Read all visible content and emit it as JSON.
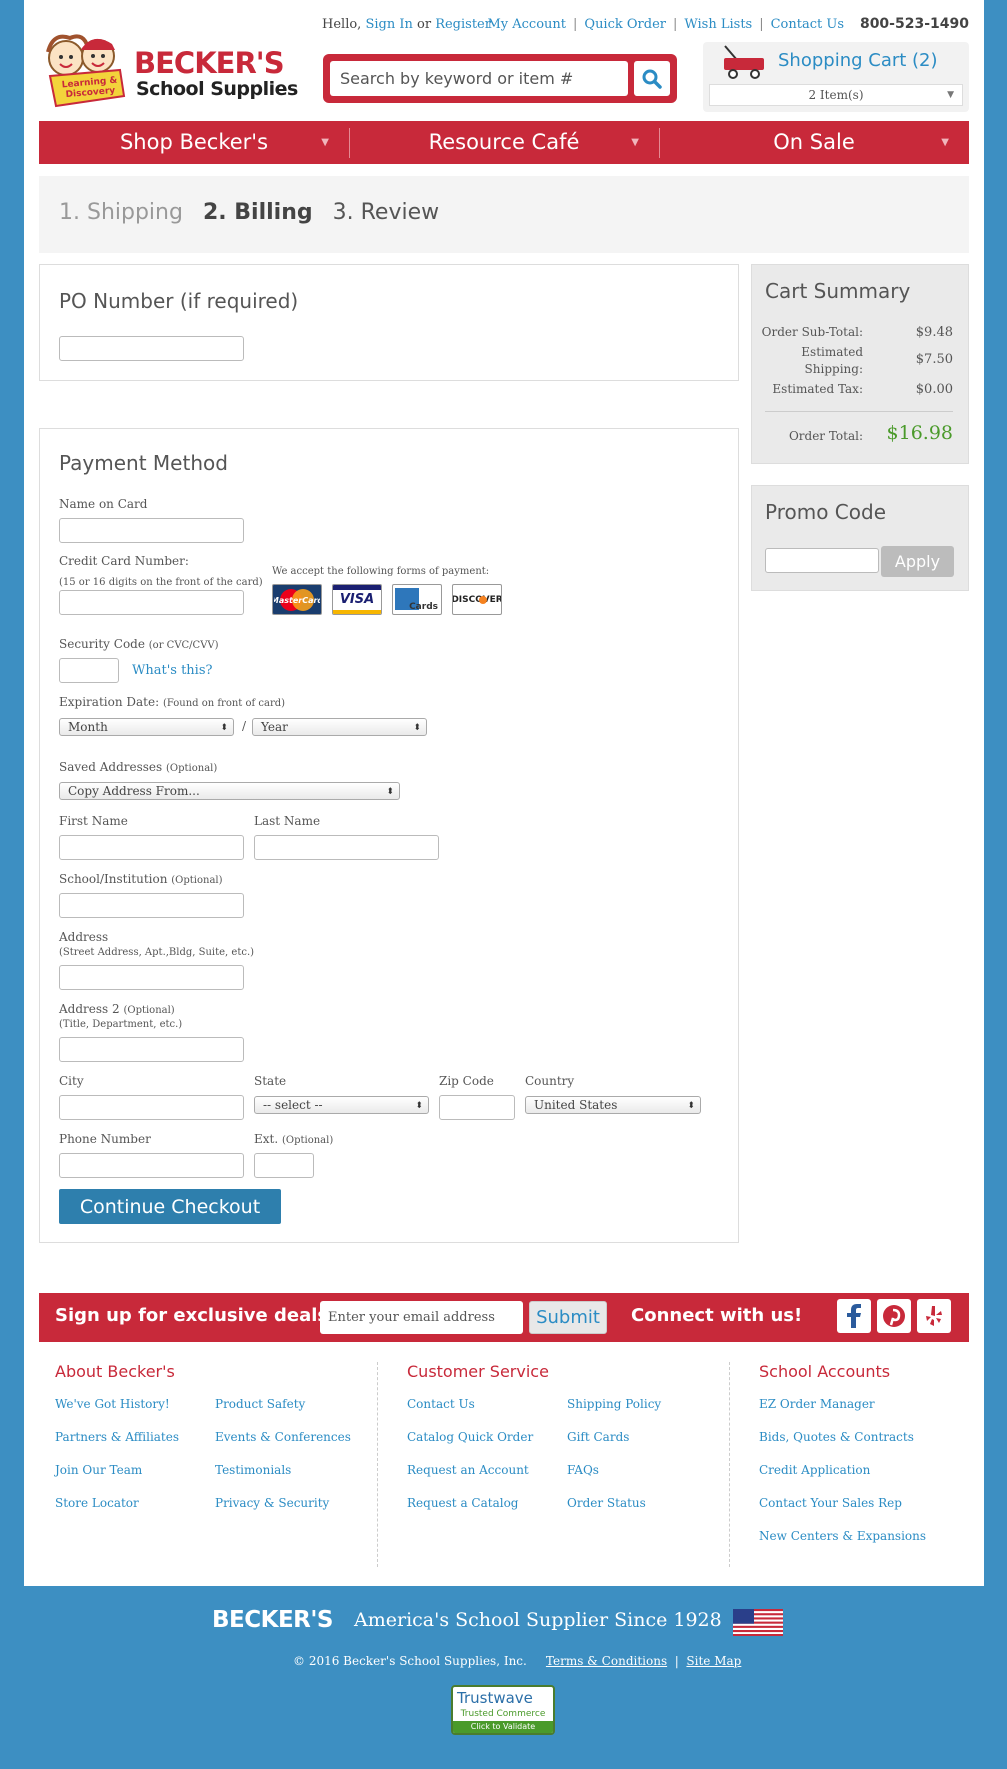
{
  "header": {
    "greeting": "Hello,",
    "sign_in": "Sign In",
    "or": "or",
    "register": "Register",
    "links": [
      "My Account",
      "Quick Order",
      "Wish Lists",
      "Contact Us"
    ],
    "phone": "800-523-1490",
    "logo_line1": "BECKER'S",
    "logo_line2": "School Supplies",
    "logo_badge": "Learning & Discovery",
    "search_placeholder": "Search by keyword or item #",
    "cart_title": "Shopping Cart (2)",
    "cart_items": "2 Item(s)"
  },
  "nav": [
    "Shop Becker's",
    "Resource Café",
    "On Sale"
  ],
  "steps": [
    "1. Shipping",
    "2. Billing",
    "3. Review"
  ],
  "po": {
    "title": "PO Number (if required)"
  },
  "payment": {
    "title": "Payment Method",
    "name_on_card": "Name on Card",
    "cc_number": "Credit Card Number:",
    "cc_hint": "(15 or 16 digits on the front of the card)",
    "accept_text": "We accept the following forms of payment:",
    "cards": [
      "MasterCard",
      "VISA",
      "Cards",
      "DISCOVER"
    ],
    "security_code": "Security Code",
    "security_hint": "(or CVC/CVV)",
    "whats_this": "What's this?",
    "expiration": "Expiration Date:",
    "expiration_hint": "(Found on front of card)",
    "month": "Month",
    "slash": "/",
    "year": "Year",
    "saved_addresses": "Saved Addresses",
    "optional": "(Optional)",
    "copy_from": "Copy Address From...",
    "first_name": "First Name",
    "last_name": "Last Name",
    "school": "School/Institution",
    "address": "Address",
    "address_hint": "(Street Address, Apt.,Bldg, Suite, etc.)",
    "address2": "Address 2",
    "address2_hint": "(Title, Department, etc.)",
    "city": "City",
    "state": "State",
    "state_value": "-- select --",
    "zip": "Zip Code",
    "country": "Country",
    "country_value": "United States",
    "phone": "Phone Number",
    "ext": "Ext.",
    "continue": "Continue Checkout"
  },
  "summary": {
    "title": "Cart Summary",
    "subtotal_label": "Order Sub-Total:",
    "subtotal": "$9.48",
    "shipping_label1": "Estimated",
    "shipping_label2": "Shipping:",
    "shipping": "$7.50",
    "tax_label": "Estimated Tax:",
    "tax": "$0.00",
    "total_label": "Order Total:",
    "total": "$16.98"
  },
  "promo": {
    "title": "Promo Code",
    "apply": "Apply"
  },
  "signup": {
    "text": "Sign up for exclusive deals!",
    "email_placeholder": "Enter your email address",
    "submit": "Submit",
    "connect": "Connect with us!"
  },
  "footer": {
    "col1_title": "About Becker's",
    "col1a": [
      "We've Got History!",
      "Partners & Affiliates",
      "Join Our Team",
      "Store Locator"
    ],
    "col1b": [
      "Product Safety",
      "Events & Conferences",
      "Testimonials",
      "Privacy & Security"
    ],
    "col2_title": "Customer Service",
    "col2a": [
      "Contact Us",
      "Catalog Quick Order",
      "Request an Account",
      "Request a Catalog"
    ],
    "col2b": [
      "Shipping Policy",
      "Gift Cards",
      "FAQs",
      "Order Status"
    ],
    "col3_title": "School Accounts",
    "col3": [
      "EZ Order Manager",
      "Bids, Quotes & Contracts",
      "Credit Application",
      "Contact Your Sales Rep",
      "New Centers & Expansions"
    ]
  },
  "bottom": {
    "brand": "BECKER'S",
    "tagline": "America's School Supplier Since 1928",
    "copyright": "© 2016 Becker's School Supplies, Inc.",
    "terms": "Terms & Conditions",
    "sitemap": "Site Map",
    "trust_line1": "Trustwave",
    "trust_line2": "Trusted Commerce",
    "trust_line3": "Click to Validate"
  },
  "colors": {
    "brand_red": "#c8293a",
    "brand_blue": "#3d8fc2",
    "link_blue": "#2b8cc4",
    "total_green": "#4a9a2a"
  }
}
